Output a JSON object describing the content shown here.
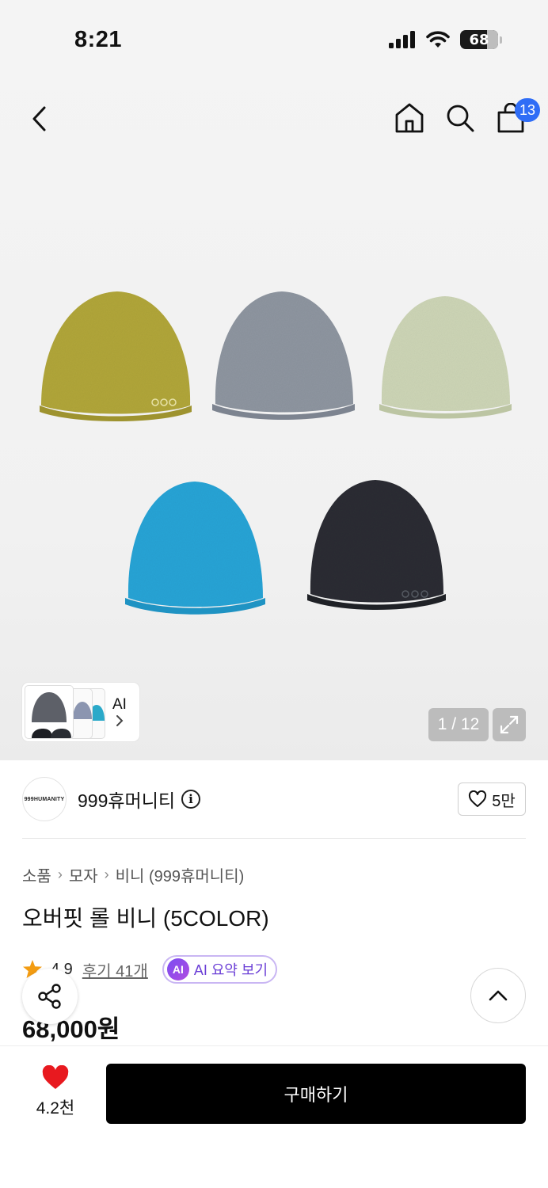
{
  "status_bar": {
    "time": "8:21",
    "battery": "68"
  },
  "nav": {
    "cart_count": "13"
  },
  "gallery": {
    "image_alt": "오버핏 롤 비니 5색 상품 이미지",
    "ai_thumb_label": "AI",
    "counter": "1 / 12",
    "colors": [
      "#b1a63a",
      "#8e95a0",
      "#cdd5b6",
      "#27a4d6",
      "#2a2d33"
    ]
  },
  "brand": {
    "logo_text": "999HUMANITY",
    "name": "999휴머니티",
    "likes": "5만"
  },
  "breadcrumb": [
    "소품",
    "모자",
    "비니 (999휴머니티)"
  ],
  "product": {
    "title": "오버핏 롤 비니 (5COLOR)",
    "rating": "4.9",
    "reviews": "후기 41개",
    "ai_summary": "AI 요약 보기",
    "ai_badge": "AI",
    "price": "68,000원"
  },
  "bottom_bar": {
    "wish_count": "4.2천",
    "buy_label": "구매하기"
  },
  "colors": {
    "accent_blue": "#2f6df6",
    "heart_red": "#e8191f",
    "star_orange": "#f39c12",
    "ai_purple": "#6b3fd6"
  }
}
